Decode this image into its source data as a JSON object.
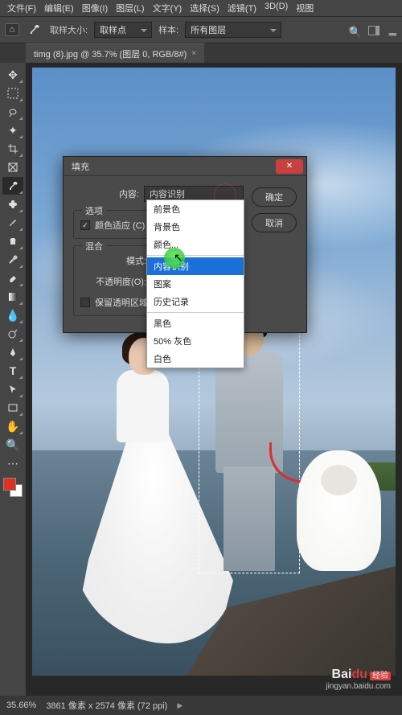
{
  "menu": [
    "文件(F)",
    "编辑(E)",
    "图像(I)",
    "图层(L)",
    "文字(Y)",
    "选择(S)",
    "滤镜(T)",
    "3D(D)",
    "视图"
  ],
  "optbar": {
    "sample_size_label": "取样大小:",
    "sample_size_value": "取样点",
    "sample_label": "样本:",
    "sample_value": "所有图层"
  },
  "tab": {
    "name": "timg (8).jpg @ 35.7% (图层 0, RGB/8#)",
    "close": "×"
  },
  "dialog": {
    "title": "填充",
    "ok": "确定",
    "cancel": "取消",
    "content_label": "内容:",
    "content_value": "内容识别",
    "options_legend": "选项",
    "color_adapt": "颜色适应 (C)",
    "blend_legend": "混合",
    "mode_label": "模式:",
    "opacity_label": "不透明度(O):",
    "preserve_trans": "保留透明区域"
  },
  "dropdown": {
    "items": [
      "前景色",
      "背景色",
      "颜色..."
    ],
    "hl": "内容识别",
    "items2": [
      "图案",
      "历史记录"
    ],
    "items3": [
      "黑色",
      "50% 灰色",
      "白色"
    ]
  },
  "status": {
    "zoom": "35.66%",
    "doc": "3861 像素 x 2574 像素 (72 ppi)"
  },
  "watermark": {
    "brand": "Bai",
    "du": "du",
    "jy": "经验",
    "url": "jingyan.baidu.com"
  },
  "tools": [
    "move",
    "rect-marquee",
    "lasso",
    "magic-wand",
    "crop",
    "frame",
    "eyedropper",
    "healing",
    "brush",
    "clone",
    "history-brush",
    "eraser",
    "gradient",
    "blur",
    "dodge",
    "pen",
    "type",
    "path-select",
    "rectangle",
    "hand",
    "zoom",
    "more"
  ]
}
